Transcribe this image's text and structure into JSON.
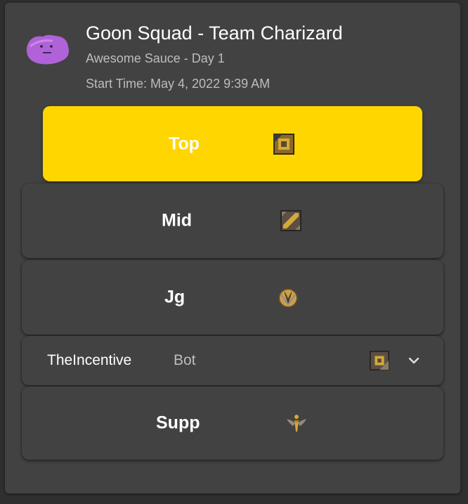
{
  "header": {
    "avatar_icon": "purple-blob-avatar-icon",
    "title": "Goon Squad - Team Charizard",
    "subtitle": "Awesome Sauce - Day 1",
    "start_time": "Start Time: May 4, 2022 9:39 AM"
  },
  "roles": [
    {
      "label": "Top",
      "icon": "top-lane-icon",
      "state": "selected"
    },
    {
      "label": "Mid",
      "icon": "mid-lane-icon"
    },
    {
      "label": "Jg",
      "icon": "jungle-icon"
    },
    {
      "player": "TheIncentive",
      "label": "Bot",
      "icon": "bot-lane-icon",
      "expand_icon": "chevron-down-icon"
    },
    {
      "label": "Supp",
      "icon": "support-icon"
    }
  ],
  "colors": {
    "page_background": "#2f2f2f",
    "card_background": "#424242",
    "accent_selected": "#ffd600",
    "text_primary": "#ffffff",
    "text_secondary": "#bdbdbd"
  }
}
